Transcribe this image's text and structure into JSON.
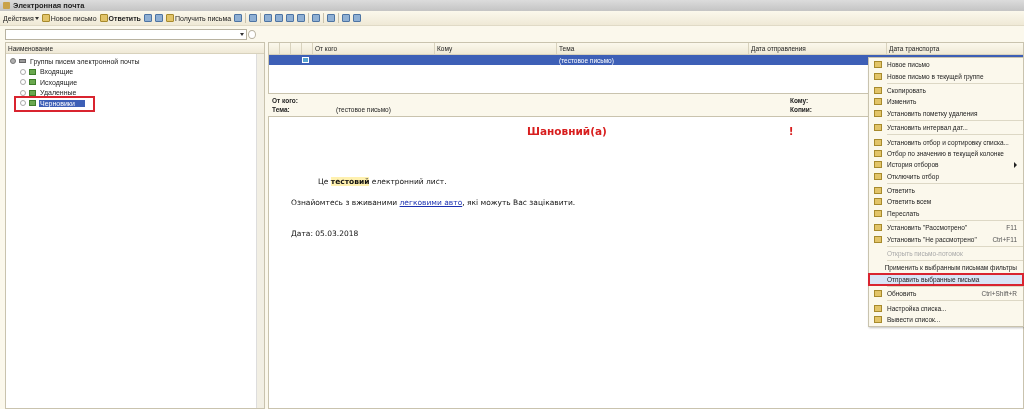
{
  "window": {
    "title": "Электронная почта"
  },
  "toolbar": [
    {
      "kind": "menu",
      "label": "Действия"
    },
    {
      "kind": "text",
      "label": "Новое письмо"
    },
    {
      "kind": "bold",
      "label": "Ответить"
    },
    {
      "kind": "icon"
    },
    {
      "kind": "icon"
    },
    {
      "kind": "text",
      "label": "Получить письма"
    },
    {
      "kind": "icon"
    },
    {
      "kind": "separator"
    },
    {
      "kind": "icon"
    },
    {
      "kind": "separator"
    },
    {
      "kind": "icon"
    },
    {
      "kind": "icon"
    },
    {
      "kind": "icon"
    },
    {
      "kind": "icon"
    },
    {
      "kind": "separator"
    },
    {
      "kind": "icon"
    },
    {
      "kind": "separator"
    },
    {
      "kind": "icon"
    },
    {
      "kind": "separator"
    },
    {
      "kind": "icon"
    },
    {
      "kind": "icon"
    }
  ],
  "tree": {
    "column": "Наименование",
    "items": [
      {
        "label": "Группы писем электронной почты",
        "expanded": true,
        "selected": false,
        "marked": false,
        "children": [
          {
            "label": "Входящие",
            "selected": false,
            "marked": false
          },
          {
            "label": "Исходящие",
            "selected": false,
            "marked": false
          },
          {
            "label": "Удаленные",
            "selected": false,
            "marked": false
          },
          {
            "label": "Черновики",
            "selected": true,
            "marked": true
          }
        ]
      }
    ]
  },
  "table": {
    "columns": [
      "От кого",
      "Кому",
      "Тема",
      "Дата отправления",
      "Дата транспорта"
    ],
    "rows": [
      {
        "selected": true,
        "cells": [
          "",
          "",
          "(тестовое письмо)",
          "",
          ""
        ]
      }
    ]
  },
  "preview": {
    "fields": [
      {
        "label": "От кого:"
      },
      {
        "label": "Тема:",
        "value": "(тестовое письмо)"
      }
    ],
    "fields_right": [
      {
        "label": "Кому:"
      },
      {
        "label": "Копии:"
      }
    ]
  },
  "letter": {
    "greeting": "Шановний(а)",
    "exclamation": "!",
    "paragraphs": [
      "Це **тестовий** електронний лист."
    ],
    "offer_before": "Ознайомтесь з вживаними ",
    "offer_link": "легковими авто",
    "offer_after": ", які можуть Вас зацікавити.",
    "date": "Дата: 05.03.2018"
  },
  "context_menu": [
    {
      "kind": "item",
      "label": "Новое письмо",
      "icon": true,
      "disabled": false,
      "selected": false,
      "marked": false
    },
    {
      "kind": "item",
      "label": "Новое письмо в текущей группе",
      "icon": true,
      "disabled": false,
      "selected": false,
      "marked": false
    },
    {
      "kind": "separator"
    },
    {
      "kind": "item",
      "label": "Скопировать",
      "icon": true,
      "disabled": false,
      "selected": false,
      "marked": false
    },
    {
      "kind": "item",
      "label": "Изменить",
      "icon": true,
      "disabled": false,
      "selected": false,
      "marked": false
    },
    {
      "kind": "item",
      "label": "Установить пометку удаления",
      "icon": true,
      "disabled": false,
      "selected": false,
      "marked": false
    },
    {
      "kind": "separator"
    },
    {
      "kind": "item",
      "label": "Установить интервал дат...",
      "icon": true,
      "disabled": false,
      "selected": false,
      "marked": false
    },
    {
      "kind": "separator"
    },
    {
      "kind": "item",
      "label": "Установить отбор и сортировку списка...",
      "icon": true,
      "disabled": false,
      "selected": false,
      "marked": false
    },
    {
      "kind": "item",
      "label": "Отбор по значению в текущей колонке",
      "icon": true,
      "disabled": false,
      "selected": false,
      "marked": false
    },
    {
      "kind": "item",
      "label": "История отборов",
      "icon": true,
      "submenu": true,
      "disabled": false,
      "selected": false,
      "marked": false
    },
    {
      "kind": "item",
      "label": "Отключить отбор",
      "icon": true,
      "disabled": false,
      "selected": false,
      "marked": false
    },
    {
      "kind": "separator"
    },
    {
      "kind": "item",
      "label": "Ответить",
      "icon": true,
      "disabled": false,
      "selected": false,
      "marked": false
    },
    {
      "kind": "item",
      "label": "Ответить всем",
      "icon": true,
      "disabled": false,
      "selected": false,
      "marked": false
    },
    {
      "kind": "item",
      "label": "Переслать",
      "icon": true,
      "disabled": false,
      "selected": false,
      "marked": false
    },
    {
      "kind": "separator"
    },
    {
      "kind": "item",
      "label": "Установить \"Рассмотрено\"",
      "shortcut": "F11",
      "icon": true,
      "disabled": false,
      "selected": false,
      "marked": false
    },
    {
      "kind": "item",
      "label": "Установить \"Не рассмотрено\"",
      "shortcut": "Ctrl+F11",
      "icon": true,
      "disabled": false,
      "selected": false,
      "marked": false
    },
    {
      "kind": "separator"
    },
    {
      "kind": "item",
      "label": "Открыть письмо-потомок",
      "icon": false,
      "disabled": true,
      "selected": false,
      "marked": false
    },
    {
      "kind": "separator"
    },
    {
      "kind": "item",
      "label": "Применить к выбранным письмам фильтры",
      "icon": false,
      "disabled": false,
      "selected": false,
      "marked": false
    },
    {
      "kind": "item",
      "label": "Отправить выбранные письма",
      "icon": false,
      "disabled": false,
      "selected": true,
      "marked": true
    },
    {
      "kind": "separator"
    },
    {
      "kind": "item",
      "label": "Обновить",
      "shortcut": "Ctrl+Shift+R",
      "icon": true,
      "disabled": false,
      "selected": false,
      "marked": false
    },
    {
      "kind": "separator"
    },
    {
      "kind": "item",
      "label": "Настройка списка...",
      "icon": true,
      "disabled": false,
      "selected": false,
      "marked": false
    },
    {
      "kind": "item",
      "label": "Вывести список...",
      "icon": true,
      "disabled": false,
      "selected": false,
      "marked": false
    }
  ]
}
